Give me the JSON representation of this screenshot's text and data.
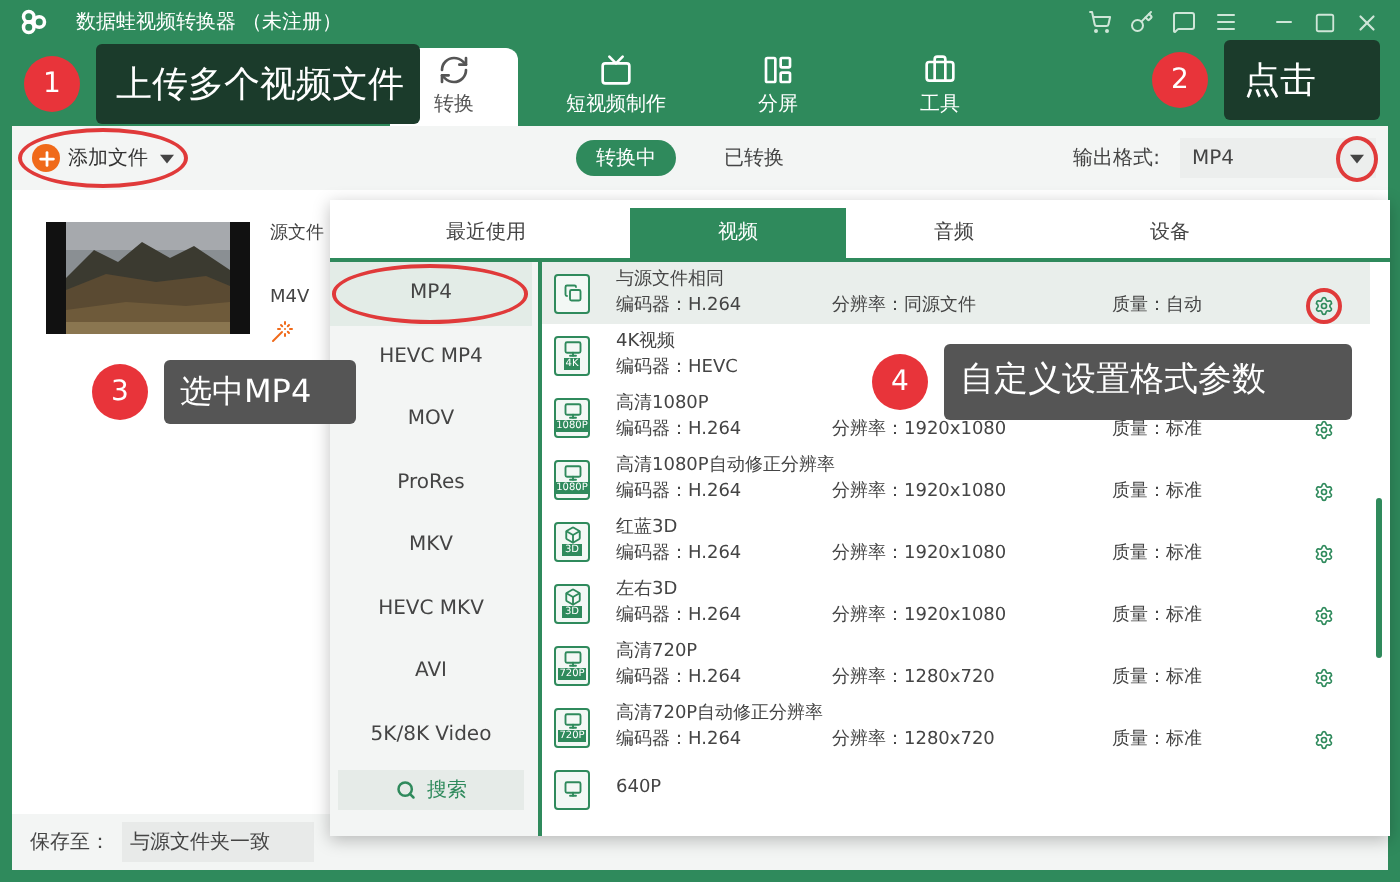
{
  "window": {
    "title": "数据蛙视频转换器 （未注册）"
  },
  "nav_tabs": [
    {
      "label": "转换",
      "selected": true
    },
    {
      "label": "短视频制作",
      "selected": false
    },
    {
      "label": "分屏",
      "selected": false
    },
    {
      "label": "工具",
      "selected": false
    }
  ],
  "toolbar": {
    "add_button": {
      "label": "添加文件",
      "circled": true
    },
    "status_tabs": [
      {
        "label": "转换中",
        "selected": true
      },
      {
        "label": "已转换",
        "selected": false
      }
    ],
    "output_format": {
      "label": "输出格式:",
      "value": "MP4",
      "circled": true
    }
  },
  "file": {
    "source_label": "源文件",
    "format": "M4V"
  },
  "save_bar": {
    "label": "保存至：",
    "value": "与源文件夹一致"
  },
  "format_panel": {
    "tabs": [
      {
        "label": "最近使用",
        "selected": false
      },
      {
        "label": "视频",
        "selected": true
      },
      {
        "label": "音频",
        "selected": false
      },
      {
        "label": "设备",
        "selected": false
      }
    ],
    "formats": [
      {
        "label": "MP4",
        "selected": true,
        "circled": true
      },
      {
        "label": "HEVC MP4",
        "selected": false,
        "circled": false
      },
      {
        "label": "MOV",
        "selected": false,
        "circled": false
      },
      {
        "label": "ProRes",
        "selected": false,
        "circled": false
      },
      {
        "label": "MKV",
        "selected": false,
        "circled": false
      },
      {
        "label": "HEVC MKV",
        "selected": false,
        "circled": false
      },
      {
        "label": "AVI",
        "selected": false,
        "circled": false
      },
      {
        "label": "5K/8K Video",
        "selected": false,
        "circled": false
      }
    ],
    "search_button": "搜索",
    "presets": [
      {
        "kind": "copy",
        "name": "与源文件相同",
        "codec": "编码器：H.264",
        "resolution": "分辨率：同源文件",
        "quality": "质量：自动",
        "selected": true,
        "circled": true
      },
      {
        "kind": "screen",
        "badge": "4K",
        "name": "4K视频",
        "codec": "编码器：HEVC",
        "selected": false,
        "circled": false
      },
      {
        "kind": "screen",
        "badge": "1080P",
        "name": "高清1080P",
        "codec": "编码器：H.264",
        "resolution": "分辨率：1920x1080",
        "quality": "质量：标准",
        "selected": false,
        "circled": false
      },
      {
        "kind": "screen",
        "badge": "1080P",
        "name": "高清1080P自动修正分辨率",
        "codec": "编码器：H.264",
        "resolution": "分辨率：1920x1080",
        "quality": "质量：标准",
        "selected": false,
        "circled": false
      },
      {
        "kind": "cube",
        "badge": "3D",
        "name": "红蓝3D",
        "codec": "编码器：H.264",
        "resolution": "分辨率：1920x1080",
        "quality": "质量：标准",
        "selected": false,
        "circled": false
      },
      {
        "kind": "cube",
        "badge": "3D",
        "name": "左右3D",
        "codec": "编码器：H.264",
        "resolution": "分辨率：1920x1080",
        "quality": "质量：标准",
        "selected": false,
        "circled": false
      },
      {
        "kind": "screen",
        "badge": "720P",
        "name": "高清720P",
        "codec": "编码器：H.264",
        "resolution": "分辨率：1280x720",
        "quality": "质量：标准",
        "selected": false,
        "circled": false
      },
      {
        "kind": "screen",
        "badge": "720P",
        "name": "高清720P自动修正分辨率",
        "codec": "编码器：H.264",
        "resolution": "分辨率：1280x720",
        "quality": "质量：标准",
        "selected": false,
        "circled": false
      },
      {
        "kind": "screen",
        "name": "640P",
        "selected": false,
        "circled": false
      }
    ]
  },
  "callouts": [
    {
      "number": "1",
      "text": "上传多个视频文件",
      "color": "#1b3b2b"
    },
    {
      "number": "2",
      "text": "点击",
      "color": "#1b3b2b"
    },
    {
      "number": "3",
      "text": "选中MP4",
      "color": "#555555"
    },
    {
      "number": "4",
      "text": "自定义设置格式参数",
      "color": "#555555"
    }
  ]
}
